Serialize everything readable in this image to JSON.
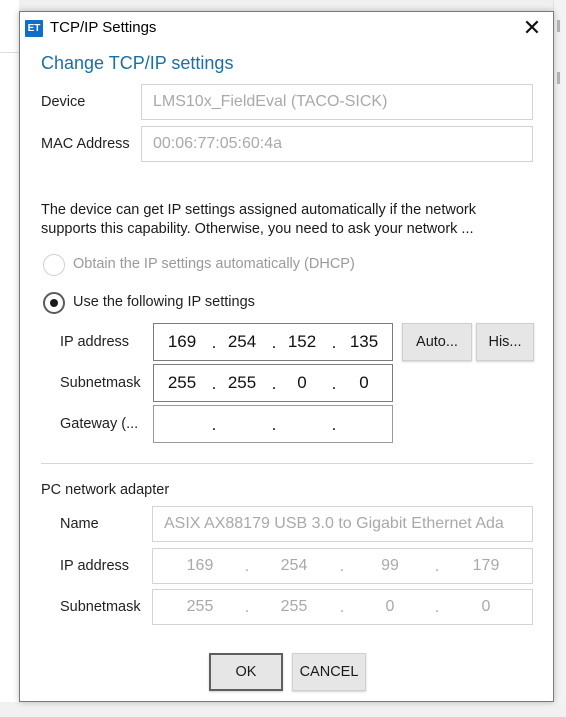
{
  "window": {
    "icon_text": "ET",
    "title": "TCP/IP Settings",
    "close_glyph": "✕"
  },
  "heading": "Change TCP/IP settings",
  "device": {
    "label": "Device",
    "value": "LMS10x_FieldEval (TACO-SICK)"
  },
  "mac": {
    "label": "MAC Address",
    "value": "00:06:77:05:60:4a"
  },
  "description": {
    "line1": "The device can get IP settings assigned automatically if the network",
    "line2": "supports this capability. Otherwise, you need to ask your network ..."
  },
  "dhcp_option": {
    "label": "Obtain the IP settings automatically (DHCP)",
    "enabled": false,
    "selected": false
  },
  "static_option": {
    "label": "Use the following IP settings",
    "selected": true
  },
  "ip_address": {
    "label": "IP address",
    "octets": [
      "169",
      "254",
      "152",
      "135"
    ]
  },
  "subnetmask": {
    "label": "Subnetmask",
    "octets": [
      "255",
      "255",
      "0",
      "0"
    ]
  },
  "gateway": {
    "label": "Gateway (...",
    "octets": [
      "",
      "",
      "",
      ""
    ]
  },
  "separator": ".",
  "buttons": {
    "auto": "Auto...",
    "history": "His...",
    "ok": "OK",
    "cancel": "CANCEL"
  },
  "adapter": {
    "section_label": "PC network adapter",
    "name_label": "Name",
    "name_value": "ASIX AX88179 USB 3.0 to Gigabit Ethernet Ada",
    "ip_label": "IP address",
    "ip_octets": [
      "169",
      "254",
      "99",
      "179"
    ],
    "mask_label": "Subnetmask",
    "mask_octets": [
      "255",
      "255",
      "0",
      "0"
    ]
  },
  "colors": {
    "heading": "#1b6fa6",
    "app_icon": "#0e6ec8",
    "disabled_text": "#a9a9a9"
  }
}
